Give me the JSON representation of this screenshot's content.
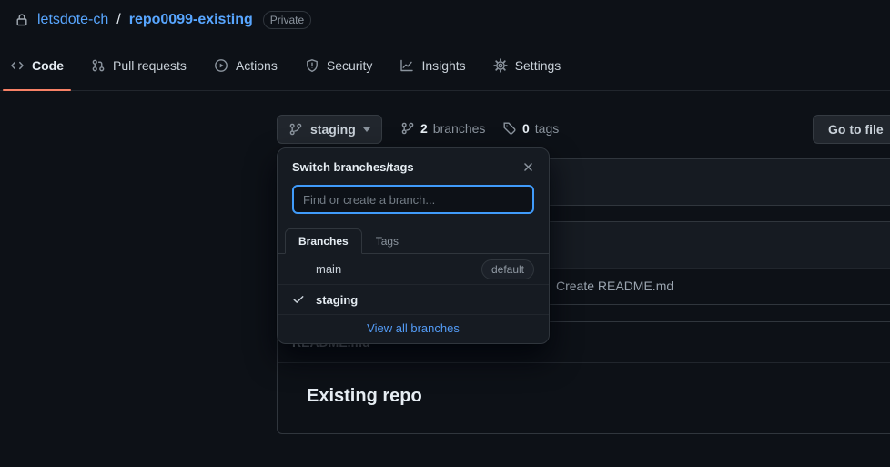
{
  "header": {
    "owner": "letsdote-ch",
    "separator": "/",
    "repo": "repo0099-existing",
    "visibility_badge": "Private"
  },
  "nav": {
    "tabs": [
      {
        "label": "Code",
        "icon": "code-icon",
        "active": true
      },
      {
        "label": "Pull requests",
        "icon": "pull-request-icon",
        "active": false
      },
      {
        "label": "Actions",
        "icon": "play-circle-icon",
        "active": false
      },
      {
        "label": "Security",
        "icon": "shield-icon",
        "active": false
      },
      {
        "label": "Insights",
        "icon": "graph-icon",
        "active": false
      },
      {
        "label": "Settings",
        "icon": "gear-icon",
        "active": false
      }
    ]
  },
  "toolbar": {
    "branch_button_label": "staging",
    "branches_count": "2",
    "branches_label": "branches",
    "tags_count": "0",
    "tags_label": "tags",
    "go_to_file_label": "Go to file"
  },
  "branch_menu": {
    "title": "Switch branches/tags",
    "filter_placeholder": "Find or create a branch...",
    "filter_value": "",
    "tabs": [
      {
        "label": "Branches",
        "active": true
      },
      {
        "label": "Tags",
        "active": false
      }
    ],
    "items": [
      {
        "name": "main",
        "badge": "default",
        "checked": false
      },
      {
        "name": "staging",
        "badge": "",
        "checked": true
      }
    ],
    "footer_link": "View all branches"
  },
  "file_table": {
    "rows": [
      {
        "commit_message": "Create README.md"
      }
    ]
  },
  "readme": {
    "header_label": "README.md",
    "heading": "Existing repo"
  },
  "colors": {
    "page_bg": "#0d1117",
    "panel_bg": "#161b22",
    "border": "#30363d",
    "link_blue": "#58a6ff",
    "tab_underline_orange": "#f78166",
    "focus_border_blue": "#409bfa",
    "text_default": "#c9d1d9",
    "text_muted": "#8b949e"
  }
}
